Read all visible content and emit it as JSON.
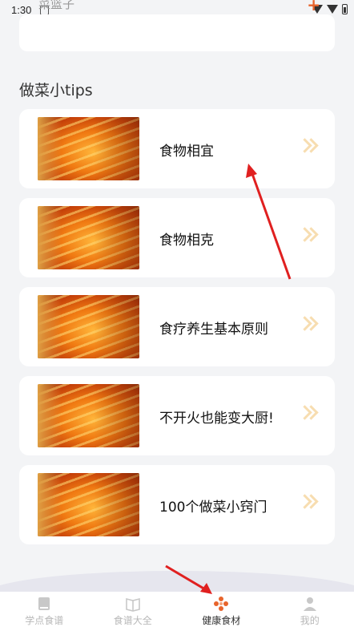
{
  "status_bar": {
    "time": "1:30"
  },
  "header": {
    "partial_title": "菜篮子"
  },
  "section": {
    "title": "做菜小tips"
  },
  "tips": [
    {
      "label": "食物相宜"
    },
    {
      "label": "食物相克"
    },
    {
      "label": "食疗养生基本原则"
    },
    {
      "label": "不开火也能变大厨!"
    },
    {
      "label": "100个做菜小窍门"
    }
  ],
  "tab_bar": {
    "tabs": [
      {
        "label": "学点食谱",
        "icon": "book-filled-icon",
        "active": false
      },
      {
        "label": "食谱大全",
        "icon": "open-book-icon",
        "active": false
      },
      {
        "label": "健康食材",
        "icon": "ingredients-icon",
        "active": true
      },
      {
        "label": "我的",
        "icon": "user-icon",
        "active": false
      }
    ]
  },
  "colors": {
    "accent": "#e8642c",
    "arrow": "#f7ddb0",
    "annotation": "#e02020"
  }
}
